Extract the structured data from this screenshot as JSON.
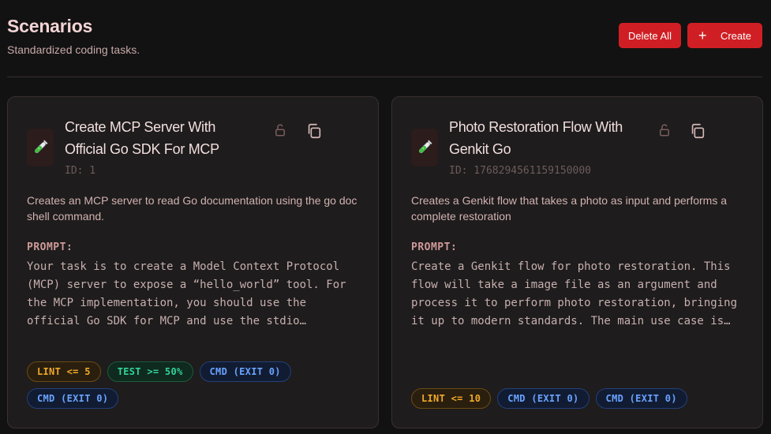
{
  "header": {
    "title": "Scenarios",
    "subtitle": "Standardized coding tasks.",
    "delete_all_label": "Delete All",
    "create_label": "Create",
    "create_icon": "+"
  },
  "colors": {
    "background": "#121212",
    "accent": "#d01f24",
    "card_bg": "#1e1c1c",
    "lint": "#f0a92a",
    "test": "#34d399",
    "cmd": "#6aa3ff"
  },
  "cards": [
    {
      "icon": "test-tube-icon",
      "title": "Create MCP Server With Official Go SDK For MCP",
      "id_text": "ID: 1",
      "description": "Creates an MCP server to read Go documentation using the go doc shell command.",
      "prompt_label": "PROMPT:",
      "prompt": "Your task is to create a Model Context Protocol (MCP) server to expose a “hello_world” tool. For the MCP implementation, you should use the official Go SDK for MCP and use the stdio transport.",
      "tags": [
        "LINT <= 5",
        "TEST >= 50%",
        "CMD (EXIT 0)",
        "CMD (EXIT 0)"
      ]
    },
    {
      "icon": "test-tube-icon",
      "title": "Photo Restoration Flow With Genkit Go",
      "id_text": "ID: 1768294561159150000",
      "description": "Creates a Genkit flow that takes a photo as input and performs a complete restoration",
      "prompt_label": "PROMPT:",
      "prompt": "Create a Genkit flow for photo restoration. This flow will take a image file as an argument and process it to perform photo restoration, bringing it up to modern standards. The main use case is to restore old photos.",
      "tags": [
        "LINT <= 10",
        "CMD (EXIT 0)",
        "CMD (EXIT 0)"
      ]
    }
  ]
}
